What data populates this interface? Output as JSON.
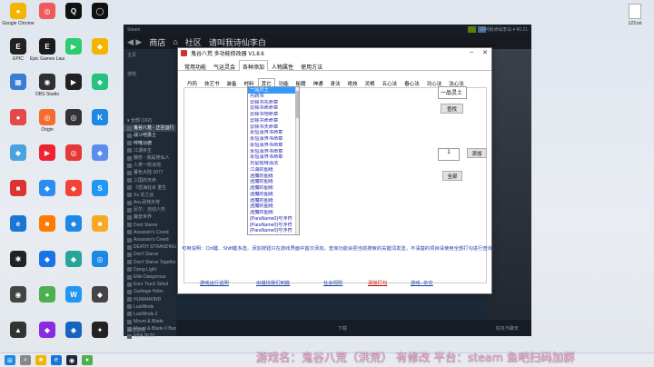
{
  "desktop": {
    "col1": [
      {
        "label": "Google Chrome",
        "color": "#f5b400",
        "glyph": "●",
        "icon": "chrome-icon"
      },
      {
        "label": "EPIC",
        "color": "#222222",
        "glyph": "E",
        "icon": "epic-icon"
      },
      {
        "label": "",
        "color": "#3a7bd5",
        "glyph": "▦",
        "icon": "monitor-icon"
      },
      {
        "label": "",
        "color": "#e54848",
        "glyph": "●",
        "icon": "app-icon"
      },
      {
        "label": "",
        "color": "#4aa3df",
        "glyph": "◆",
        "icon": "app-icon"
      },
      {
        "label": "",
        "color": "#d33",
        "glyph": "■",
        "icon": "app-icon"
      },
      {
        "label": "",
        "color": "#1976d2",
        "glyph": "e",
        "icon": "edge-icon"
      },
      {
        "label": "",
        "color": "#222",
        "glyph": "✱",
        "icon": "app-icon"
      },
      {
        "label": "",
        "color": "#444",
        "glyph": "◉",
        "icon": "app-icon"
      },
      {
        "label": "",
        "color": "#333",
        "glyph": "▲",
        "icon": "app-icon"
      }
    ],
    "col2": [
      {
        "label": "",
        "color": "#ef5a5a",
        "glyph": "◎",
        "icon": "app-icon"
      },
      {
        "label": "Epic Games Launcher",
        "color": "#1b1b1b",
        "glyph": "E",
        "icon": "epic-games-icon"
      },
      {
        "label": "OBS Studio",
        "color": "#303030",
        "glyph": "◉",
        "icon": "obs-icon"
      },
      {
        "label": "Origin",
        "color": "#f56c2d",
        "glyph": "◎",
        "icon": "origin-icon"
      },
      {
        "label": "",
        "color": "#e23",
        "glyph": "▶",
        "icon": "app-icon"
      },
      {
        "label": "",
        "color": "#2d8cf0",
        "glyph": "◆",
        "icon": "app-icon"
      },
      {
        "label": "",
        "color": "#ff7a00",
        "glyph": "■",
        "icon": "app-icon"
      },
      {
        "label": "",
        "color": "#1a73e8",
        "glyph": "◆",
        "icon": "app-icon"
      },
      {
        "label": "",
        "color": "#4caf50",
        "glyph": "●",
        "icon": "app-icon"
      },
      {
        "label": "",
        "color": "#8a2be2",
        "glyph": "◆",
        "icon": "app-icon"
      }
    ],
    "col3": [
      {
        "label": "",
        "color": "#111",
        "glyph": "Q",
        "icon": "qq-icon"
      },
      {
        "label": "",
        "color": "#2ecc71",
        "glyph": "▶",
        "icon": "app-icon"
      },
      {
        "label": "",
        "color": "#222",
        "glyph": "▶",
        "icon": "app-icon"
      },
      {
        "label": "",
        "color": "#333",
        "glyph": "◎",
        "icon": "app-icon"
      },
      {
        "label": "",
        "color": "#e53935",
        "glyph": "◎",
        "icon": "app-icon"
      },
      {
        "label": "",
        "color": "#f44336",
        "glyph": "◆",
        "icon": "app-icon"
      },
      {
        "label": "",
        "color": "#1e88e5",
        "glyph": "◆",
        "icon": "app-icon"
      },
      {
        "label": "",
        "color": "#26a69a",
        "glyph": "◆",
        "icon": "app-icon"
      },
      {
        "label": "",
        "color": "#2196f3",
        "glyph": "W",
        "icon": "app-icon"
      },
      {
        "label": "",
        "color": "#1565c0",
        "glyph": "◆",
        "icon": "app-icon"
      }
    ],
    "col4": [
      {
        "label": "",
        "color": "#111",
        "glyph": "◯",
        "icon": "app-icon"
      },
      {
        "label": "",
        "color": "#f5b400",
        "glyph": "◆",
        "icon": "app-icon"
      },
      {
        "label": "",
        "color": "#26c281",
        "glyph": "◆",
        "icon": "app-icon"
      },
      {
        "label": "",
        "color": "#1e88e5",
        "glyph": "K",
        "icon": "app-icon"
      },
      {
        "label": "",
        "color": "#5b8def",
        "glyph": "◆",
        "icon": "app-icon"
      },
      {
        "label": "",
        "color": "#2196f3",
        "glyph": "S",
        "icon": "app-icon"
      },
      {
        "label": "",
        "color": "#f9a825",
        "glyph": "■",
        "icon": "folder-icon"
      },
      {
        "label": "",
        "color": "#1e88e5",
        "glyph": "◎",
        "icon": "app-icon"
      },
      {
        "label": "",
        "color": "#444",
        "glyph": "◆",
        "icon": "app-icon"
      },
      {
        "label": "",
        "color": "#222",
        "glyph": "✦",
        "icon": "app-icon"
      }
    ],
    "file_label": "123.txt"
  },
  "steam": {
    "topbar": "Steam",
    "nav": {
      "store": "商店",
      "community": "社区",
      "user": "请叫我诗仙李白"
    },
    "user_badge": "请叫我诗仙李白 ▾  ¥0.21",
    "home": "主页",
    "games_label": "游戏",
    "category": "▾ 全部 (162)",
    "games": [
      "鬼谷八荒 - 正在运行",
      "战斗吧勇士",
      "呼噜功德",
      "江湖余生",
      "散修 - 我是修仙人",
      "人类一败涂地",
      "暮色大陆 2077",
      "三国的天命",
      "《怒海狂杀 重生",
      "Xs 龙之谷",
      "Ara 武林外传",
      "尼尔：自动人形",
      "魔兽世界",
      "Dont Starve",
      "Assassin's Creed",
      "Assassin's Creed",
      "DEATH STRANDING",
      "Don't Starve",
      "Don't Starve Together",
      "Dying Light",
      "Elite Dangerous",
      "Euro Truck Simul",
      "Garbage Hobo",
      "HUMANKIND",
      "LuaWinds",
      "LuaWinds 2",
      "Mount & Blade",
      "Mount & Blade II Bannerlord",
      "NBA 2K20"
    ],
    "add_game": "添加游戏",
    "bottom_center": "下载",
    "bottom_right": "好友与聊天"
  },
  "trainer": {
    "title": "鬼谷八荒 多功能修改器 V1.8.6",
    "tabs": [
      "常用功能",
      "气运灵会",
      "各种添加",
      "人物属性",
      "使用方法"
    ],
    "active_tab": 2,
    "subtabs": [
      "丹药",
      "技艺书",
      "装备",
      "材料",
      "其它",
      "功能",
      "秘籍",
      "神通",
      "身法",
      "绝技",
      "灵根",
      "五心法",
      "春心法",
      "功心法",
      "法心法"
    ],
    "active_subtab": 4,
    "items": [
      "一品灵土",
      "丹药书",
      "云顿书先命章",
      "云顿书命命章",
      "云顿书地命章",
      "云顿书命命章",
      "云顿书天命章",
      "永恒消界书命章",
      "永恒消界书命章",
      "永恒消界书命章",
      "永恒消界书命章",
      "永恒消界书命章",
      "日星帕特消法",
      "江湖的图纸",
      "迷魔的图纸",
      "迷魔的图纸",
      "迷魔的图纸",
      "迷魔的图纸",
      "迷魔的图纸",
      "迷魔的图纸",
      "迷魔的图纸",
      "{ParaName0}号浮符",
      "{ParaName0}号浮符",
      "{ParaName0}号浮符",
      "{ParaName0}号浮符",
      "{ParaName1}号浮符",
      "{ParaName0}号浮符",
      "{ParaName1}号浮符"
    ],
    "selected_item": "一品灵土",
    "search_value": "一品灵土",
    "search_btn": "查找",
    "qty_value": "1",
    "add_btn": "添加",
    "all_btn": "全部",
    "note": "可用说明：Ctrl键、Shift键多选，添加按钮只在游戏界面中首次添加，查询功能会把当前搜索的关键词发送，不清楚的项目请使用全部打勾进行查询。",
    "links": [
      "游戏运行说明",
      "出错找我们到底",
      "社会规则",
      "添加打勾",
      "游戏--杂交",
      "--"
    ]
  },
  "overlay": "游戏名：鬼谷八荒（洪荒） 有修改 平台：steam 鱼吧扫码加群"
}
